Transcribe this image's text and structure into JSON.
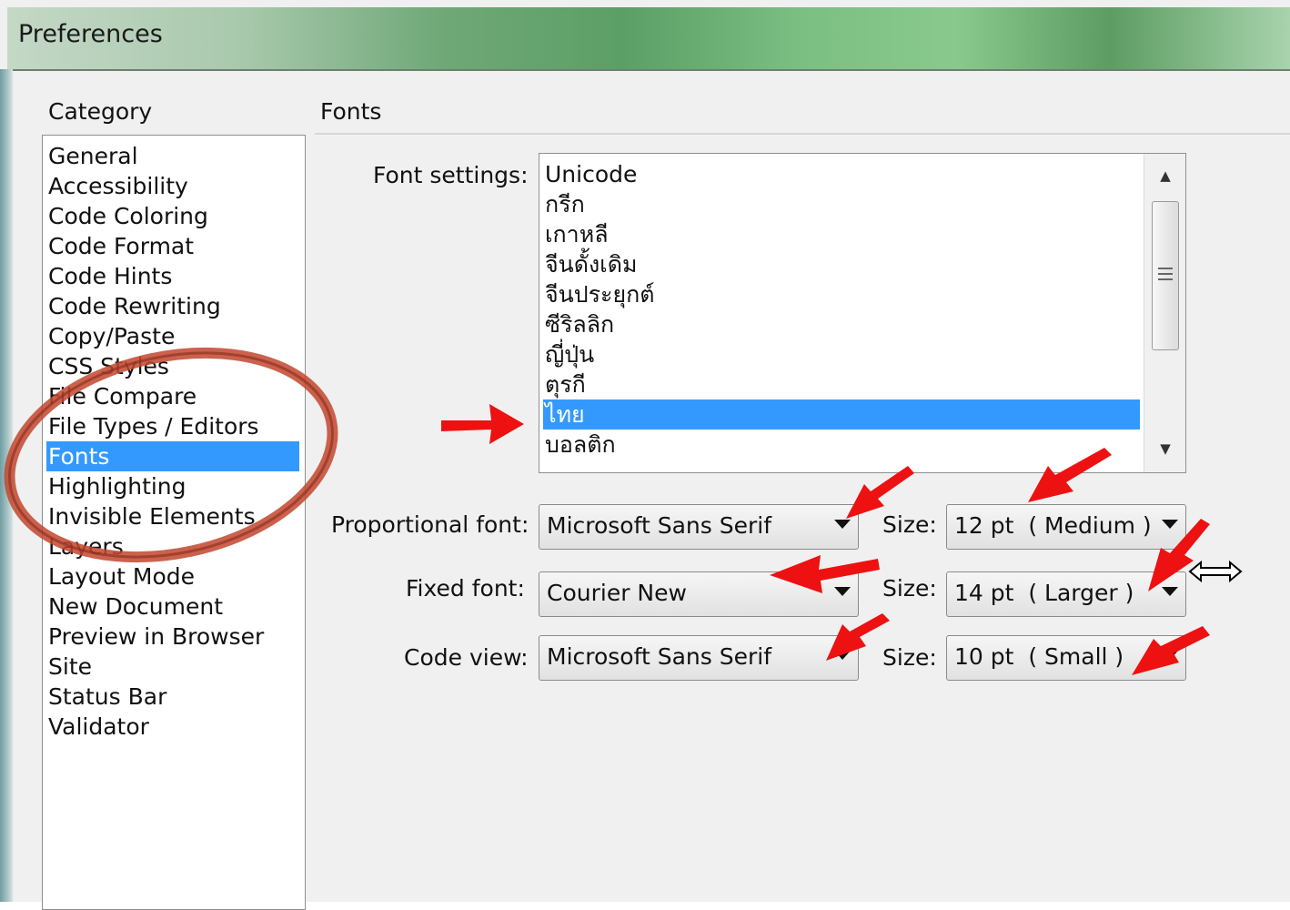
{
  "window": {
    "title": "Preferences"
  },
  "category": {
    "heading": "Category",
    "items": [
      "General",
      "Accessibility",
      "Code Coloring",
      "Code Format",
      "Code Hints",
      "Code Rewriting",
      "Copy/Paste",
      "CSS Styles",
      "File Compare",
      "File Types / Editors",
      "Fonts",
      "Highlighting",
      "Invisible Elements",
      "Layers",
      "Layout Mode",
      "New Document",
      "Preview in Browser",
      "Site",
      "Status Bar",
      "Validator"
    ],
    "selected": "Fonts"
  },
  "panel": {
    "title": "Fonts"
  },
  "font_settings": {
    "label": "Font settings:",
    "items": [
      "Unicode",
      "กรีก",
      "เกาหลี",
      "จีนดั้งเดิม",
      "จีนประยุกต์",
      "ซีริลลิก",
      "ญี่ปุ่น",
      "ตุรกี",
      "ไทย",
      "บอลติก"
    ],
    "selected": "ไทย"
  },
  "rows": [
    {
      "label": "Proportional font:",
      "font": "Microsoft Sans Serif",
      "size_label": "Size:",
      "size": "12 pt  ( Medium )"
    },
    {
      "label": "Fixed font:",
      "font": "Courier New",
      "size_label": "Size:",
      "size": "14 pt  ( Larger )"
    },
    {
      "label": "Code view:",
      "font": "Microsoft Sans Serif",
      "size_label": "Size:",
      "size": "10 pt  ( Small )"
    }
  ],
  "colors": {
    "selection": "#3399ff",
    "annotation_red": "#ee1111",
    "circle": "#c2462e"
  },
  "icons": {
    "scroll_up": "scroll-up-icon",
    "scroll_down": "scroll-down-icon",
    "dropdown": "chevron-down-icon",
    "resize_cursor": "resize-horizontal-icon"
  }
}
